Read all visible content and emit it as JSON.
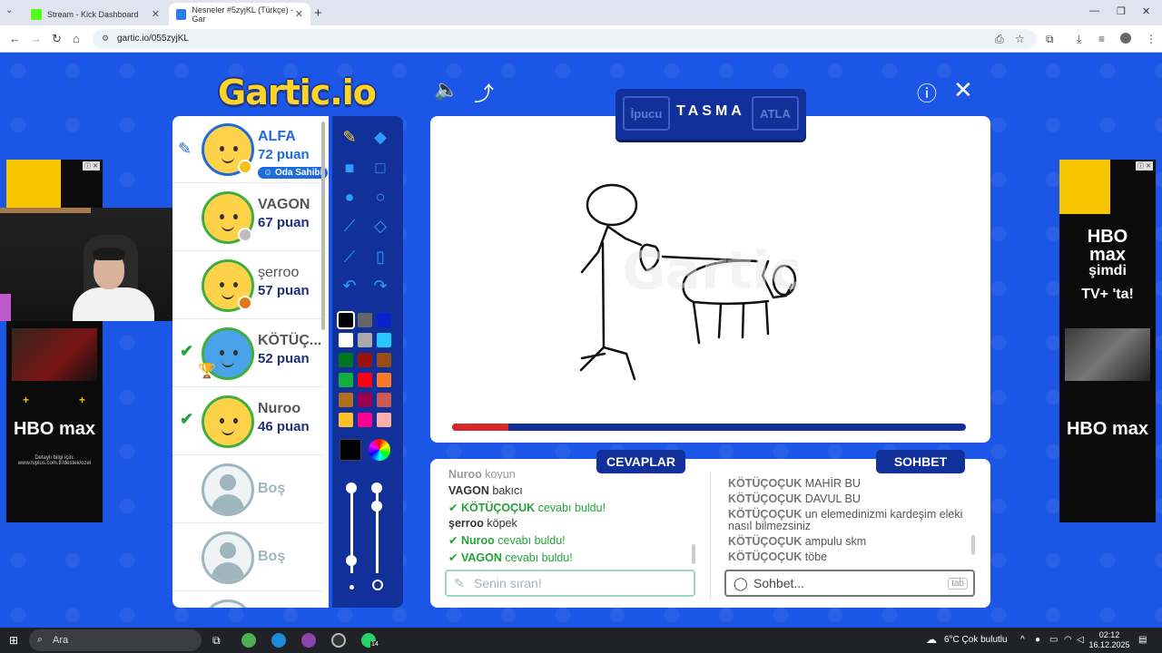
{
  "browser": {
    "tabs": [
      {
        "title": "Stream - Kick Dashboard",
        "favicon_color": "#53fc18"
      },
      {
        "title": "Nesneler #5zyjKL (Türkçe) - Gar",
        "favicon_color": "#2b7de9"
      }
    ],
    "url": "gartic.io/055zyjKL"
  },
  "logo": {
    "text": "Gartic.io"
  },
  "word_bar": {
    "hint_label": "İpucu",
    "word": "TASMA",
    "skip_label": "ATLA"
  },
  "players": [
    {
      "name": "ALFA",
      "score": "72 puan",
      "badge": "Oda Sahibi",
      "medal_color": "#f2c21b",
      "drawing": true,
      "guessed": false
    },
    {
      "name": "VAGON",
      "score": "67 puan",
      "medal_color": "#bdbdbd",
      "drawing": false,
      "guessed": false
    },
    {
      "name": "şerroo",
      "score": "57 puan",
      "medal_color": "#e07a16",
      "drawing": false,
      "guessed": false
    },
    {
      "name": "KÖTÜÇ...",
      "score": "52 puan",
      "drawing": false,
      "guessed": true,
      "trophy": true
    },
    {
      "name": "Nuroo",
      "score": "46 puan",
      "drawing": false,
      "guessed": true
    },
    {
      "name": "Boş"
    },
    {
      "name": "Boş"
    }
  ],
  "palette": [
    "#000000",
    "#666666",
    "#0a22c9",
    "#ffffff",
    "#aaaaaa",
    "#26c9ff",
    "#017420",
    "#991111",
    "#994c1b",
    "#11b03c",
    "#ff0013",
    "#ff7829",
    "#b0701c",
    "#99004e",
    "#cb5a57",
    "#ffc126",
    "#ff008f",
    "#feafa8"
  ],
  "progress": {
    "fraction": 0.11
  },
  "answers": {
    "title": "CEVAPLAR",
    "messages": [
      {
        "name": "Nuroo",
        "text": "koyun"
      },
      {
        "name": "VAGON",
        "text": "bakıcı"
      },
      {
        "name": "KÖTÜÇOÇUK",
        "text": "cevabı buldu!",
        "correct": true
      },
      {
        "name": "şerroo",
        "text": "köpek"
      },
      {
        "name": "Nuroo",
        "text": "cevabı buldu!",
        "correct": true
      },
      {
        "name": "VAGON",
        "text": "cevabı buldu!",
        "correct": true
      }
    ],
    "input_placeholder": "Senin sıran!"
  },
  "chat": {
    "title": "SOHBET",
    "messages": [
      {
        "name": "KÖTÜÇOÇUK",
        "text": "MAHİR BU"
      },
      {
        "name": "KÖTÜÇOÇUK",
        "text": "DAVUL BU"
      },
      {
        "name": "KÖTÜÇOÇUK",
        "text": "un elemedinizmi kardeşim eleki"
      },
      {
        "name": "",
        "text": "nasıl bilmezsiniz"
      },
      {
        "name": "KÖTÜÇOÇUK",
        "text": "ampulu skm"
      },
      {
        "name": "KÖTÜÇOÇUK",
        "text": "töbe"
      }
    ],
    "input_placeholder": "Sohbet...",
    "tab_key": "tab"
  },
  "ads": {
    "brand": "HBO max",
    "left_small": "Detaylı bilgi için: www.tvplus.com.tr/destek/ozel",
    "right_line1": "HBO",
    "right_line2": "max",
    "right_line3": "şimdi",
    "right_line4": "TV+ 'ta!"
  },
  "taskbar": {
    "search_label": "Ara",
    "weather": "6°C  Çok bulutlu",
    "time": "02:12",
    "date": "16.12.2025",
    "whatsapp_count": "14"
  }
}
